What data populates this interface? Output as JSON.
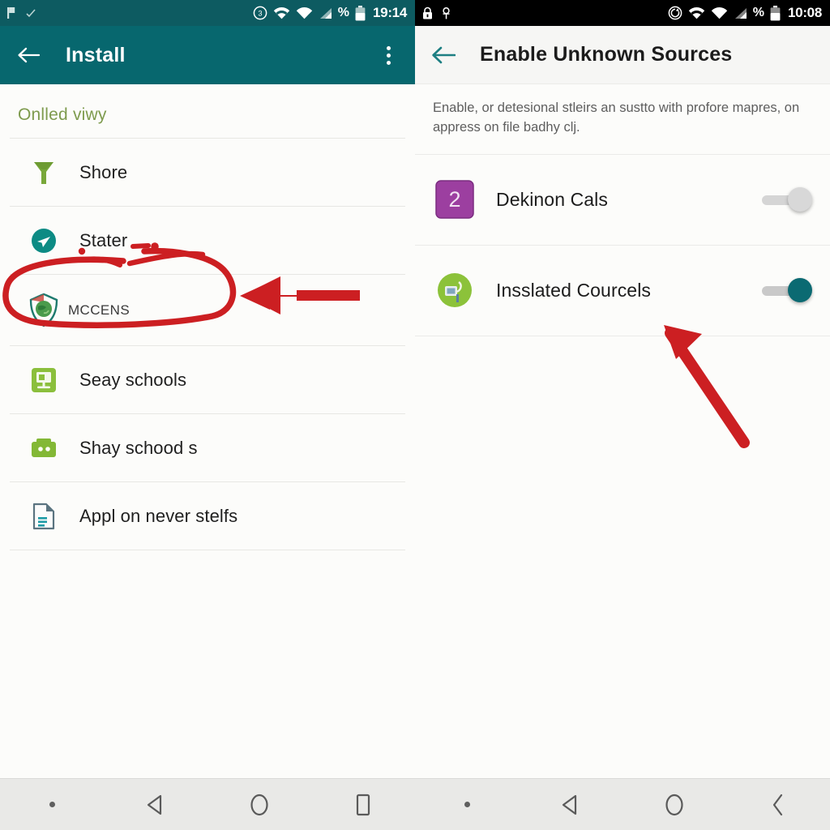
{
  "left_phone": {
    "status_bar": {
      "time": "19:14",
      "percent_glyph": "%",
      "icons": [
        "flag-icon",
        "check-icon",
        "cast-icon",
        "wifi-icon",
        "signal-full-icon",
        "signal-bars-icon",
        "battery-icon"
      ]
    },
    "app_bar": {
      "back_icon": "back-arrow-icon",
      "title": "Install",
      "overflow_icon": "overflow-menu-icon"
    },
    "section_header": "Onlled viwy",
    "items": [
      {
        "label": "Shore",
        "icon": "funnel-icon",
        "icon_color": "#79a83a"
      },
      {
        "label": "Stater",
        "icon": "send-circle-icon",
        "icon_color": "#0d8b84"
      },
      {
        "label": "MCCENS",
        "icon": "shield-globe-logo-icon",
        "icon_color": "#1d7a6e",
        "highlighted": true
      },
      {
        "label": "Seay schools",
        "icon": "monitor-icon",
        "icon_color": "#8bbf3c"
      },
      {
        "label": "Shay schood s",
        "icon": "robot-case-icon",
        "icon_color": "#83b836"
      },
      {
        "label": "Appl on never stelfs",
        "icon": "document-icon",
        "icon_color": "#5b7480"
      }
    ],
    "nav": [
      "dot-indicator",
      "back-triangle-icon",
      "home-circle-icon",
      "recents-square-icon"
    ]
  },
  "right_phone": {
    "status_bar": {
      "time": "10:08",
      "percent_glyph": "%",
      "icons": [
        "lock-icon",
        "pin-icon",
        "sync-icon",
        "wifi-icon",
        "signal-full-icon",
        "signal-bars-icon",
        "battery-icon"
      ]
    },
    "app_bar": {
      "back_icon": "back-arrow-icon",
      "title": "Enable Unknown Sources"
    },
    "description": "Enable, or detesional stleirs an sustto with profore mapres, on appress on file badhy clj.",
    "toggles": [
      {
        "label": "Dekinon Cals",
        "icon": "badge-2-icon",
        "icon_color": "#9c3fa0",
        "badge_text": "2",
        "state": "off"
      },
      {
        "label": "Insslated Courcels",
        "icon": "green-app-icon",
        "icon_color": "#8cc23a",
        "state": "on"
      }
    ],
    "nav": [
      "dot-indicator",
      "back-triangle-icon",
      "home-circle-icon",
      "chevron-back-icon"
    ]
  },
  "annotations": {
    "color": "#cc1f22",
    "ellipse_label": "red-circle-highlight",
    "arrow_left_label": "red-arrow-pointing-left",
    "arrow_right_label": "red-arrow-pointing-up-left"
  },
  "colors": {
    "teal_appbar": "#07676e",
    "teal_statusbar": "#0d5b61",
    "accent_green": "#7e9b4e",
    "toggle_on": "#0b6a72",
    "annotation_red": "#cc1f22"
  }
}
